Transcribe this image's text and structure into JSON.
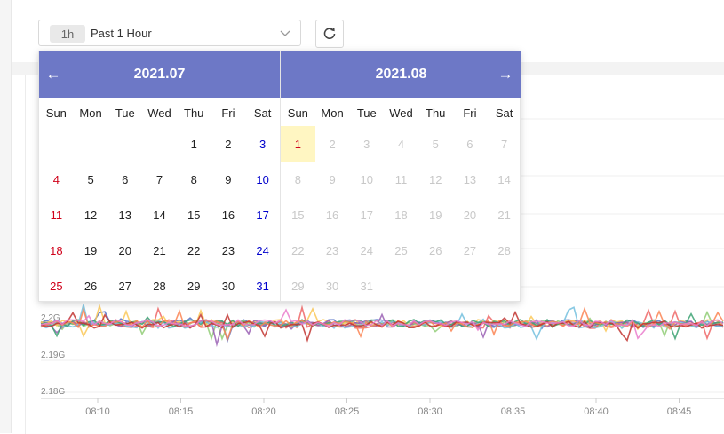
{
  "toolbar": {
    "time_badge": "1h",
    "time_label": "Past 1 Hour"
  },
  "calendar": {
    "weekdays": [
      "Sun",
      "Mon",
      "Tue",
      "Wed",
      "Thu",
      "Fri",
      "Sat"
    ],
    "left_title": "2021.07",
    "right_title": "2021.08",
    "left_days": [
      "",
      "",
      "",
      "",
      "1",
      "2",
      "3",
      "4",
      "5",
      "6",
      "7",
      "8",
      "9",
      "10",
      "11",
      "12",
      "13",
      "14",
      "15",
      "16",
      "17",
      "18",
      "19",
      "20",
      "21",
      "22",
      "23",
      "24",
      "25",
      "26",
      "27",
      "28",
      "29",
      "30",
      "31"
    ],
    "right_days": [
      "1",
      "2",
      "3",
      "4",
      "5",
      "6",
      "7",
      "8",
      "9",
      "10",
      "11",
      "12",
      "13",
      "14",
      "15",
      "16",
      "17",
      "18",
      "19",
      "20",
      "21",
      "22",
      "23",
      "24",
      "25",
      "26",
      "27",
      "28",
      "29",
      "30",
      "31"
    ],
    "selected_day": "1"
  },
  "chart_data": {
    "type": "line",
    "y_ticks": [
      "2.2G",
      "2.19G",
      "2.18G"
    ],
    "x_ticks": [
      "08:10",
      "08:15",
      "08:20",
      "08:25",
      "08:30",
      "08:35",
      "08:40",
      "08:45"
    ],
    "series_colors": [
      "#5470c6",
      "#91cc75",
      "#ee6666",
      "#fac858",
      "#9a60b4",
      "#73c0de",
      "#3ba272",
      "#fc8452",
      "#c23531",
      "#ea7ccc"
    ]
  }
}
